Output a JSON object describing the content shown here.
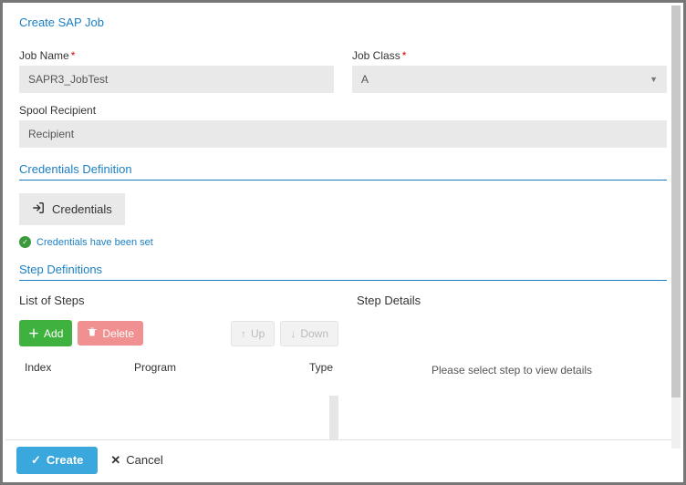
{
  "dialog": {
    "title": "Create SAP Job"
  },
  "fields": {
    "job_name": {
      "label": "Job Name",
      "value": "SAPR3_JobTest"
    },
    "job_class": {
      "label": "Job Class",
      "value": "A"
    },
    "spool_recipient": {
      "label": "Spool Recipient",
      "value": "Recipient"
    }
  },
  "sections": {
    "credentials_title": "Credentials Definition",
    "step_defs_title": "Step Definitions"
  },
  "credentials": {
    "button_label": "Credentials",
    "status_text": "Credentials have been set"
  },
  "steps": {
    "list_title": "List of Steps",
    "details_title": "Step Details",
    "add_label": "Add",
    "delete_label": "Delete",
    "up_label": "Up",
    "down_label": "Down",
    "columns": {
      "index": "Index",
      "program": "Program",
      "type": "Type"
    },
    "details_placeholder": "Please select step to view details"
  },
  "footer": {
    "create_label": "Create",
    "cancel_label": "Cancel"
  }
}
